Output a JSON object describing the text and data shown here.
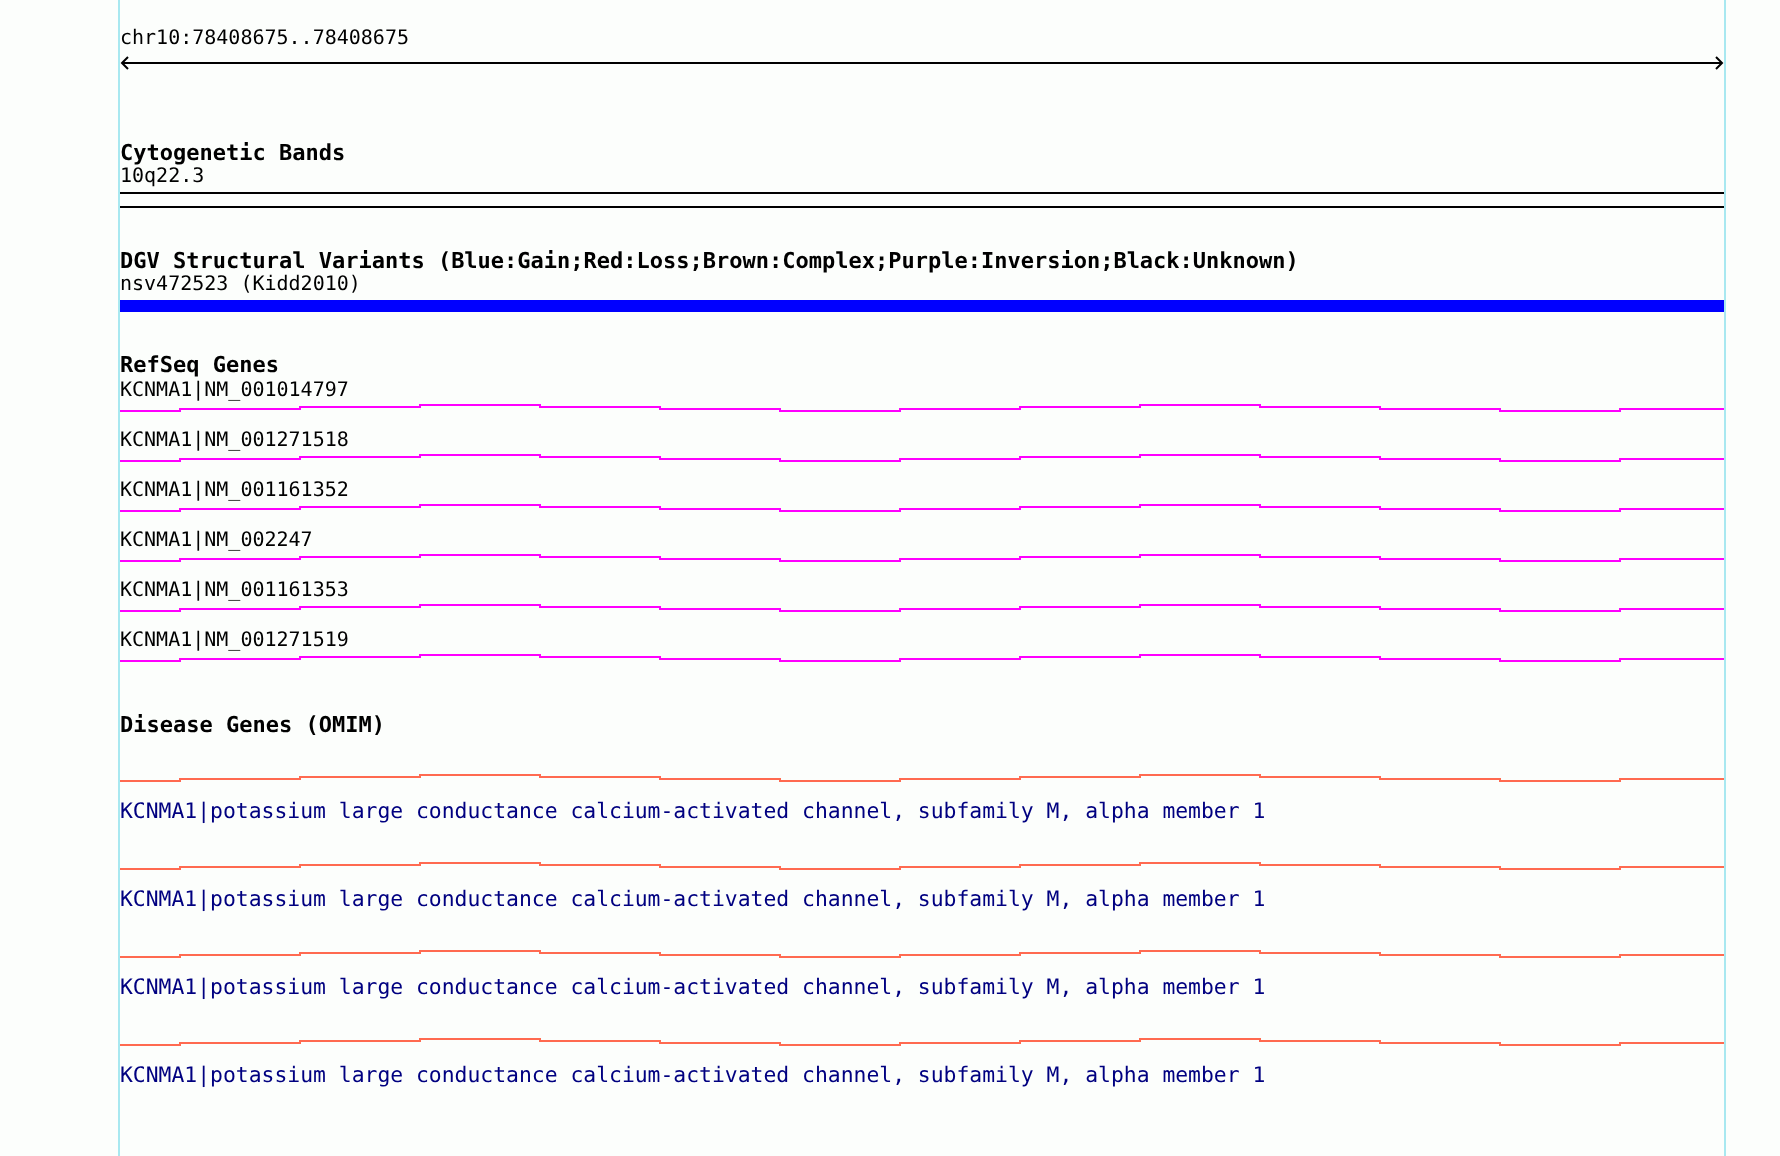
{
  "position": {
    "label": "chr10:78408675..78408675"
  },
  "tracks": [
    {
      "kind": "band",
      "title": "Cytogenetic Bands",
      "features": [
        {
          "label": "10q22.3"
        }
      ]
    },
    {
      "kind": "variant",
      "title": "DGV Structural Variants (Blue:Gain;Red:Loss;Brown:Complex;Purple:Inversion;Black:Unknown)",
      "features": [
        {
          "label": "nsv472523 (Kidd2010)",
          "color": "#0000ff"
        }
      ]
    },
    {
      "kind": "gene",
      "title": "RefSeq Genes",
      "features": [
        {
          "label": "KCNMA1|NM_001014797"
        },
        {
          "label": "KCNMA1|NM_001271518"
        },
        {
          "label": "KCNMA1|NM_001161352"
        },
        {
          "label": "KCNMA1|NM_002247"
        },
        {
          "label": "KCNMA1|NM_001161353"
        },
        {
          "label": "KCNMA1|NM_001271519"
        }
      ]
    },
    {
      "kind": "disease",
      "title": "Disease Genes (OMIM)",
      "features": [
        {
          "label": "KCNMA1|potassium large conductance calcium-activated channel, subfamily M, alpha member 1"
        },
        {
          "label": "KCNMA1|potassium large conductance calcium-activated channel, subfamily M, alpha member 1"
        },
        {
          "label": "KCNMA1|potassium large conductance calcium-activated channel, subfamily M, alpha member 1"
        },
        {
          "label": "KCNMA1|potassium large conductance calcium-activated channel, subfamily M, alpha member 1"
        }
      ]
    }
  ]
}
